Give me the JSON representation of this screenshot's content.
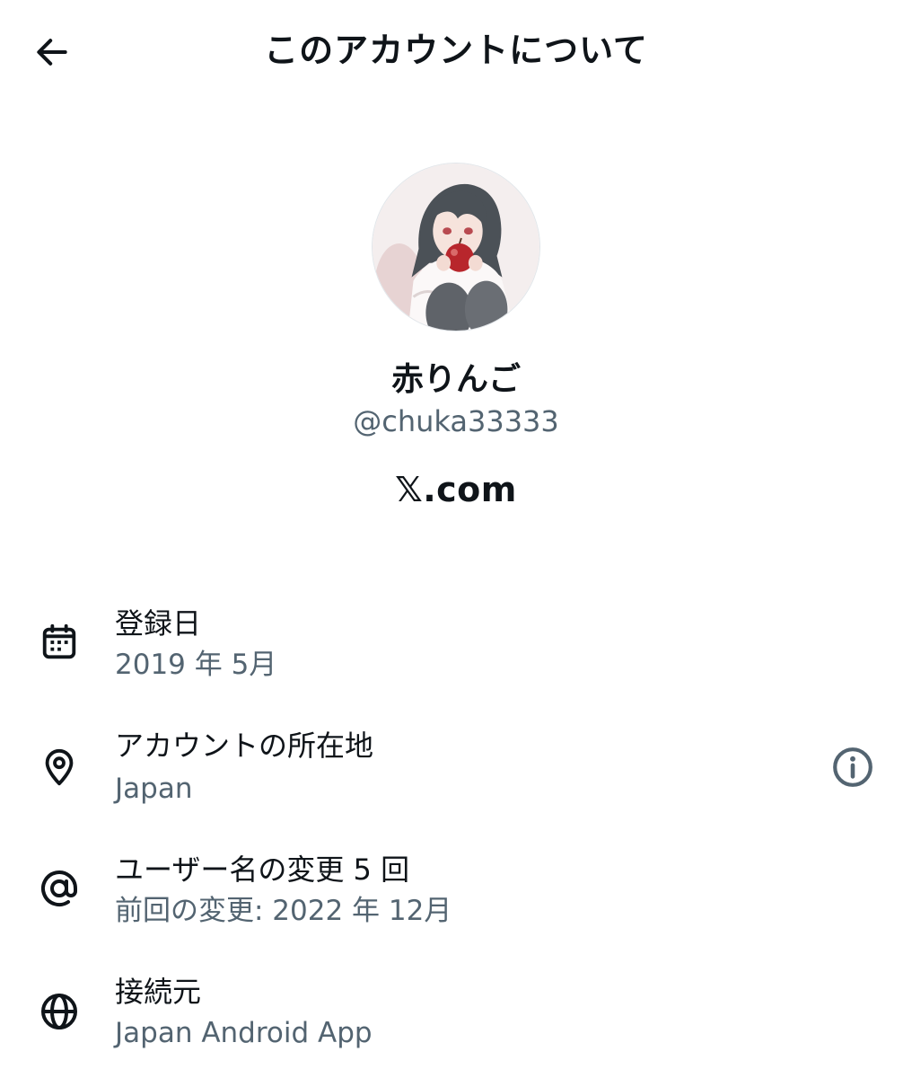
{
  "header": {
    "title": "このアカウントについて",
    "back_icon": "arrow-left-icon"
  },
  "profile": {
    "display_name": "赤りんご",
    "handle": "@chuka33333",
    "site": "𝕏.com"
  },
  "details": [
    {
      "icon": "calendar-icon",
      "title": "登録日",
      "value": "2019 年 5月"
    },
    {
      "icon": "location-pin-icon",
      "title": "アカウントの所在地",
      "value": "Japan",
      "action_icon": "info-icon"
    },
    {
      "icon": "at-sign-icon",
      "title": "ユーザー名の変更 5 回",
      "value": "前回の変更: 2022 年 12月"
    },
    {
      "icon": "globe-icon",
      "title": "接続元",
      "value": "Japan Android App"
    }
  ],
  "colors": {
    "text_primary": "#0f1419",
    "text_secondary": "#536471",
    "background": "#ffffff"
  }
}
